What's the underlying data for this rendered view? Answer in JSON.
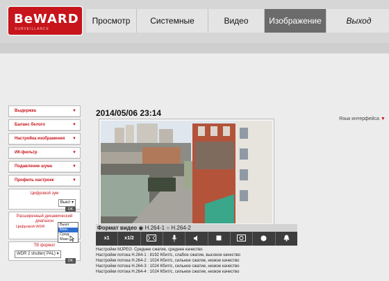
{
  "logo": {
    "main": "BeWARD",
    "sub": "SURVEILLANCE"
  },
  "nav": [
    {
      "label": "Просмотр",
      "active": false
    },
    {
      "label": "Системные",
      "active": false
    },
    {
      "label": "Видео",
      "active": false
    },
    {
      "label": "Изображение",
      "active": true
    },
    {
      "label": "Выход",
      "active": false
    }
  ],
  "lang_link": "Язык интерфейса",
  "sidebar": {
    "buttons": [
      "Выдержка",
      "Баланс белого",
      "Настройка изображения",
      "ИК-фильтр",
      "Подавление шума",
      "Профиль настроек"
    ],
    "digital_zoom": {
      "title": "Цифровой зум",
      "value": "Выкл",
      "ok": "OK"
    },
    "wdr": {
      "title": "Расширенный динамический диапазон",
      "label": "Цифровой WDR",
      "options": [
        "Выкл",
        "Мин.",
        "Сред.",
        "Макс."
      ],
      "selected": "Мин.",
      "ok": "OK"
    },
    "tv": {
      "title": "ТВ формат",
      "value": "WDR 2 shutter( PAL)",
      "ok": "OK"
    }
  },
  "timestamp": "2014/05/06 23:14",
  "format": {
    "label": "Формат видео",
    "options": [
      "H.264-1",
      "H.264-2"
    ],
    "selected": "H.264-1"
  },
  "controls": [
    "x1",
    "x1/2",
    "fit-screen-icon",
    "microphone-icon",
    "speaker-icon",
    "stop-icon",
    "snapshot-icon",
    "record-icon",
    "alarm-bell-icon"
  ],
  "info": [
    "Настройки MJPEG: Среднее сжатие, среднее качество",
    "Настройки потока H.264-1 : 8192 Кбит/с, слабое сжатие, высокое качество",
    "Настройки потока H.264-2 : 1024 Кбит/с, сильное сжатие, низкое качество",
    "Настройки потока H.264-3 : 1024 Кбит/с, сильное сжатие, низкое качество",
    "Настройки потока H.264-4 : 1024 Кбит/с, сильное сжатие, низкое качество"
  ]
}
